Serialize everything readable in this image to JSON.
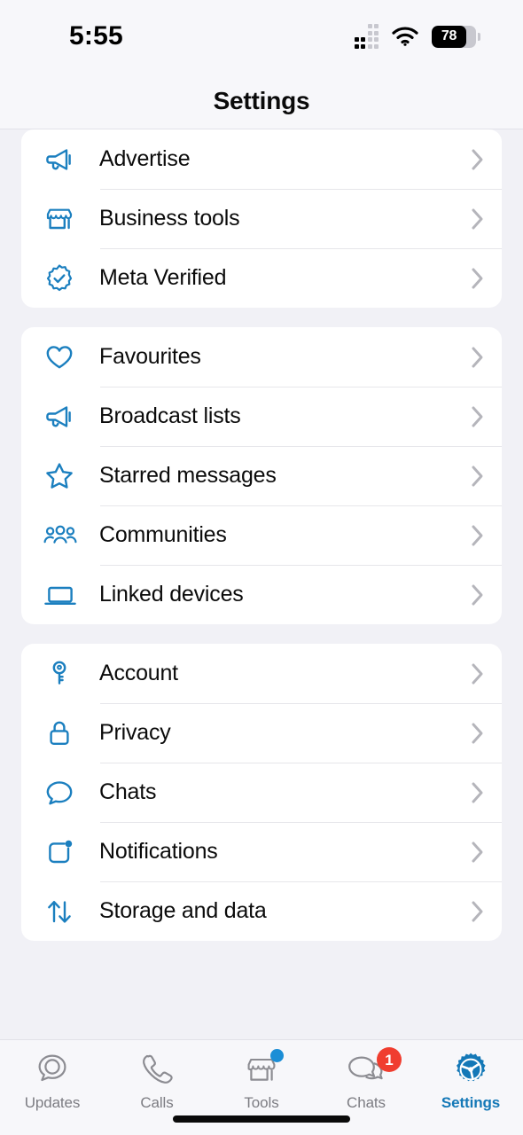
{
  "status_bar": {
    "time": "5:55",
    "cellular_icon": "signal-bars-icon",
    "wifi_icon": "wifi-icon",
    "battery_level": "78",
    "battery_icon": "battery-icon"
  },
  "header": {
    "title": "Settings"
  },
  "colors": {
    "accent_blue": "#1b7fbf",
    "active_tab_blue": "#1478b7",
    "badge_red": "#f03d2f",
    "dot_blue": "#1b8ed6",
    "page_background": "#f1f1f6",
    "card_background": "#ffffff",
    "chevron_gray": "#b5b5bb",
    "inactive_tab_gray": "#7c7c82"
  },
  "sections": [
    {
      "name": "business-section",
      "items": [
        {
          "label": "Advertise",
          "icon": "megaphone-icon",
          "chevron": "chevron-right-icon"
        },
        {
          "label": "Business tools",
          "icon": "storefront-icon",
          "chevron": "chevron-right-icon"
        },
        {
          "label": "Meta Verified",
          "icon": "verified-badge-icon",
          "chevron": "chevron-right-icon"
        }
      ]
    },
    {
      "name": "lists-section",
      "items": [
        {
          "label": "Favourites",
          "icon": "heart-icon",
          "chevron": "chevron-right-icon"
        },
        {
          "label": "Broadcast lists",
          "icon": "megaphone-icon",
          "chevron": "chevron-right-icon"
        },
        {
          "label": "Starred messages",
          "icon": "star-icon",
          "chevron": "chevron-right-icon"
        },
        {
          "label": "Communities",
          "icon": "people-icon",
          "chevron": "chevron-right-icon"
        },
        {
          "label": "Linked devices",
          "icon": "laptop-icon",
          "chevron": "chevron-right-icon"
        }
      ]
    },
    {
      "name": "account-section",
      "items": [
        {
          "label": "Account",
          "icon": "key-icon",
          "chevron": "chevron-right-icon"
        },
        {
          "label": "Privacy",
          "icon": "lock-icon",
          "chevron": "chevron-right-icon"
        },
        {
          "label": "Chats",
          "icon": "chat-bubble-icon",
          "chevron": "chevron-right-icon"
        },
        {
          "label": "Notifications",
          "icon": "notification-icon",
          "chevron": "chevron-right-icon"
        },
        {
          "label": "Storage and data",
          "icon": "arrows-updown-icon",
          "chevron": "chevron-right-icon"
        }
      ]
    }
  ],
  "tab_bar": {
    "tabs": [
      {
        "label": "Updates",
        "icon": "updates-icon",
        "active": false,
        "badge": null,
        "dot": false
      },
      {
        "label": "Calls",
        "icon": "phone-icon",
        "active": false,
        "badge": null,
        "dot": false
      },
      {
        "label": "Tools",
        "icon": "storefront-icon",
        "active": false,
        "badge": null,
        "dot": true
      },
      {
        "label": "Chats",
        "icon": "chats-icon",
        "active": false,
        "badge": "1",
        "dot": false
      },
      {
        "label": "Settings",
        "icon": "gear-icon",
        "active": true,
        "badge": null,
        "dot": false
      }
    ]
  },
  "home_indicator": "home-indicator"
}
